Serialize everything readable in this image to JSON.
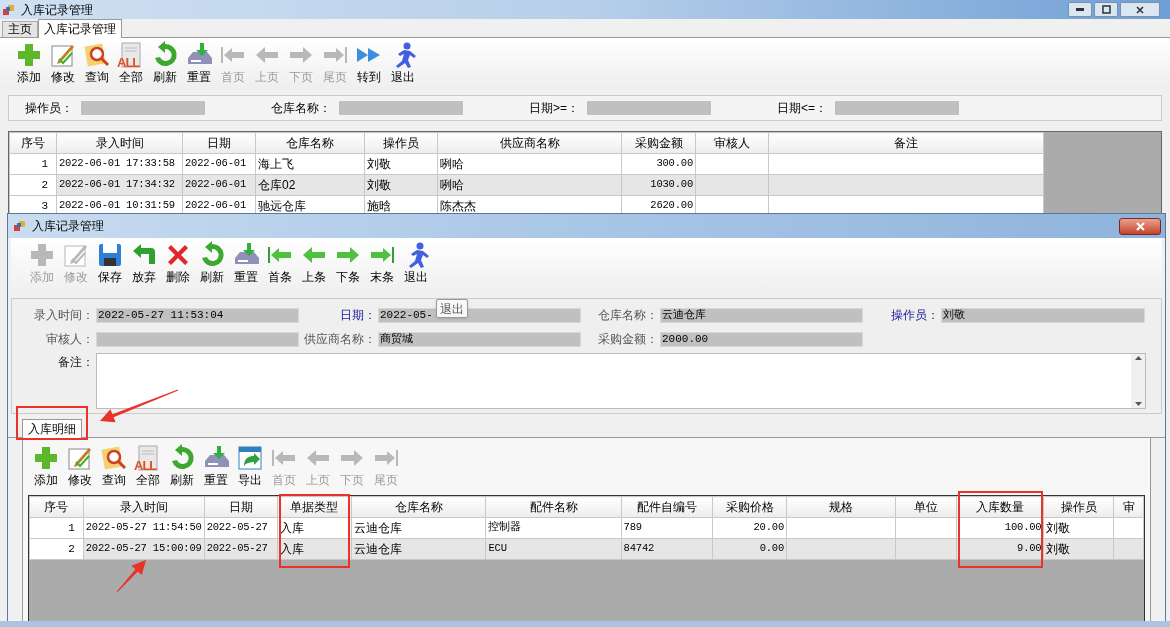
{
  "window": {
    "title": "入库记录管理",
    "tabs": [
      {
        "label": "主页",
        "selected": false
      },
      {
        "label": "入库记录管理",
        "selected": true
      }
    ]
  },
  "toolbar": [
    {
      "label": "添加",
      "kind": "add",
      "disabled": false
    },
    {
      "label": "修改",
      "kind": "edit",
      "disabled": false
    },
    {
      "label": "查询",
      "kind": "search",
      "disabled": false
    },
    {
      "label": "全部",
      "kind": "all",
      "icon_text": "ALL",
      "disabled": false
    },
    {
      "label": "刷新",
      "kind": "refresh",
      "disabled": false
    },
    {
      "label": "重置",
      "kind": "reset",
      "disabled": false
    },
    {
      "label": "首页",
      "kind": "first",
      "disabled": true
    },
    {
      "label": "上页",
      "kind": "prev",
      "disabled": true
    },
    {
      "label": "下页",
      "kind": "next",
      "disabled": true
    },
    {
      "label": "尾页",
      "kind": "last",
      "disabled": true
    },
    {
      "label": "转到",
      "kind": "goto",
      "disabled": false
    },
    {
      "label": "退出",
      "kind": "exit",
      "disabled": false
    }
  ],
  "filters": [
    {
      "label": "操作员："
    },
    {
      "label": "仓库名称："
    },
    {
      "label": "日期>=："
    },
    {
      "label": "日期<=："
    }
  ],
  "table": {
    "columns": [
      "序号",
      "录入时间",
      "日期",
      "仓库名称",
      "操作员",
      "供应商名称",
      "采购金额",
      "审核人",
      "备注"
    ],
    "rows": [
      [
        "1",
        "2022-06-01 17:33:58",
        "2022-06-01",
        "海上飞",
        "刘敬",
        "咧哈",
        "300.00",
        "",
        ""
      ],
      [
        "2",
        "2022-06-01 17:34:32",
        "2022-06-01",
        "仓库02",
        "刘敬",
        "咧哈",
        "1030.00",
        "",
        ""
      ],
      [
        "3",
        "2022-06-01 10:31:59",
        "2022-06-01",
        "驰远仓库",
        "施晗",
        "陈杰杰",
        "2620.00",
        "",
        ""
      ]
    ]
  },
  "dialog": {
    "title": "入库记录管理",
    "toolbar": [
      {
        "label": "添加",
        "kind": "add",
        "disabled": true
      },
      {
        "label": "修改",
        "kind": "edit",
        "disabled": true
      },
      {
        "label": "保存",
        "kind": "save",
        "disabled": false
      },
      {
        "label": "放弃",
        "kind": "discard",
        "disabled": false
      },
      {
        "label": "删除",
        "kind": "delete",
        "disabled": false
      },
      {
        "label": "刷新",
        "kind": "refresh",
        "disabled": false
      },
      {
        "label": "重置",
        "kind": "reset",
        "disabled": false
      },
      {
        "label": "首条",
        "kind": "first",
        "disabled": false
      },
      {
        "label": "上条",
        "kind": "prev",
        "disabled": false
      },
      {
        "label": "下条",
        "kind": "next",
        "disabled": false
      },
      {
        "label": "末条",
        "kind": "last",
        "disabled": false
      },
      {
        "label": "退出",
        "kind": "exit",
        "disabled": false
      }
    ],
    "tooltip": "退出",
    "fields": [
      {
        "label": "录入时间：",
        "value": "2022-05-27 11:53:04",
        "required": false
      },
      {
        "label": "日期：",
        "value": "2022-05-",
        "required": true
      },
      {
        "label": "仓库名称：",
        "value": "云迪仓库",
        "required": false
      },
      {
        "label": "操作员：",
        "value": "刘敬",
        "required": true
      },
      {
        "label": "审核人：",
        "required": false
      },
      {
        "label": "供应商名称：",
        "value": "商贸城",
        "required": false
      },
      {
        "label": "采购金额：",
        "value": "2000.00",
        "required": false
      }
    ],
    "remark": {
      "label": "备注："
    },
    "detail_tabs": [
      {
        "label": "入库明细",
        "selected": true
      }
    ],
    "detail_toolbar": [
      {
        "label": "添加",
        "kind": "add",
        "disabled": false
      },
      {
        "label": "修改",
        "kind": "edit",
        "disabled": false
      },
      {
        "label": "查询",
        "kind": "search",
        "disabled": false
      },
      {
        "label": "全部",
        "kind": "all",
        "icon_text": "ALL",
        "disabled": false
      },
      {
        "label": "刷新",
        "kind": "refresh",
        "disabled": false
      },
      {
        "label": "重置",
        "kind": "reset",
        "disabled": false
      },
      {
        "label": "导出",
        "kind": "export",
        "disabled": false
      },
      {
        "label": "首页",
        "kind": "first",
        "disabled": true
      },
      {
        "label": "上页",
        "kind": "prev",
        "disabled": true
      },
      {
        "label": "下页",
        "kind": "next",
        "disabled": true
      },
      {
        "label": "尾页",
        "kind": "last",
        "disabled": true
      }
    ],
    "detail_table": {
      "columns": [
        "序号",
        "录入时间",
        "日期",
        "单据类型",
        "仓库名称",
        "配件名称",
        "配件自编号",
        "采购价格",
        "规格",
        "单位",
        "入库数量",
        "操作员",
        "审"
      ],
      "rows": [
        [
          "1",
          "2022-05-27 11:54:50",
          "2022-05-27",
          "入库",
          "云迪仓库",
          "控制器",
          "789",
          "20.00",
          "",
          "",
          "100.00",
          "刘敬",
          ""
        ],
        [
          "2",
          "2022-05-27 15:00:09",
          "2022-05-27",
          "入库",
          "云迪仓库",
          "ECU",
          "84742",
          "0.00",
          "",
          "",
          "9.00",
          "刘敬",
          ""
        ]
      ]
    }
  }
}
